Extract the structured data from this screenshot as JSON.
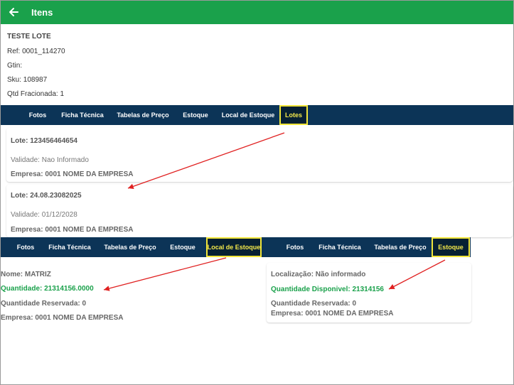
{
  "appbar": {
    "title": "Itens"
  },
  "product": {
    "name": "TESTE LOTE",
    "ref": "Ref: 0001_114270",
    "gtin": "Gtin:",
    "sku": "Sku: 108987",
    "qtd": "Qtd Fracionada: 1"
  },
  "tabs": {
    "fotos": "Fotos",
    "ficha": "Ficha Técnica",
    "tabelas": "Tabelas de Preço",
    "estoque": "Estoque",
    "local": "Local de Estoque",
    "lotes": "Lotes"
  },
  "lotes": [
    {
      "lote": "Lote: 123456464654",
      "validade_label": "Validade:",
      "validade": "Nao Informado",
      "empresa": "Empresa: 0001 NOME DA EMPRESA"
    },
    {
      "lote": "Lote: 24.08.23082025",
      "validade_label": "Validade:",
      "validade": "01/12/2028",
      "empresa": "Empresa: 0001 NOME DA EMPRESA"
    }
  ],
  "local_estoque": {
    "nome": "Nome: MATRIZ",
    "quantidade": "Quantidade:  21314156.0000",
    "reservada": "Quantidade Reservada:  0",
    "empresa": "Empresa: 0001 NOME DA EMPRESA"
  },
  "estoque": {
    "localizacao": "Localização: Não informado",
    "disponivel": "Quantidade Disponivel: 21314156",
    "reservada": "Quantidade Reservada: 0",
    "empresa": "Empresa: 0001 NOME DA EMPRESA"
  },
  "colors": {
    "appbar": "#1aa14b",
    "tabbar": "#0c3457",
    "highlight": "#f1e53a",
    "arrow": "#e02020",
    "quantity": "#1aa14b"
  },
  "icons": {
    "back": "arrow-left-icon"
  }
}
